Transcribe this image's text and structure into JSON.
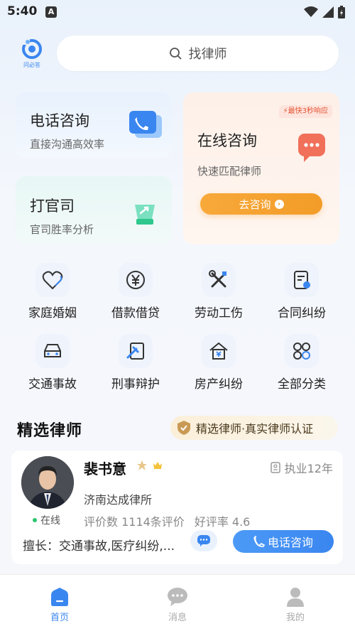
{
  "status_bar": {
    "time": "5:40",
    "notif_glyph": "A"
  },
  "header": {
    "logo_text": "问必答",
    "search_placeholder": "找律师"
  },
  "services": {
    "phone": {
      "title": "电话咨询",
      "subtitle": "直接沟通高效率"
    },
    "lawsuit": {
      "title": "打官司",
      "subtitle": "官司胜率分析"
    },
    "online": {
      "badge": "最快3秒响应",
      "title": "在线咨询",
      "subtitle": "快速匹配律师",
      "button": "去咨询"
    }
  },
  "categories": [
    {
      "label": "家庭婚姻",
      "icon": "heart-icon"
    },
    {
      "label": "借款借贷",
      "icon": "yen-icon"
    },
    {
      "label": "劳动工伤",
      "icon": "tools-icon"
    },
    {
      "label": "合同纠纷",
      "icon": "contract-icon"
    },
    {
      "label": "交通事故",
      "icon": "car-icon"
    },
    {
      "label": "刑事辩护",
      "icon": "gavel-icon"
    },
    {
      "label": "房产纠纷",
      "icon": "house-icon"
    },
    {
      "label": "全部分类",
      "icon": "grid-icon"
    }
  ],
  "featured": {
    "title": "精选律师",
    "badge": "精选律师·真实律师认证"
  },
  "lawyer": {
    "name": "裴书意",
    "experience": "执业12年",
    "firm": "济南达成律所",
    "status": "在线",
    "reviews": "评价数 1114条评价",
    "rating": "好评率 4.6",
    "specialty": "擅长：交通事故,医疗纠纷,...",
    "call_button": "电话咨询"
  },
  "tabs": [
    {
      "label": "首页",
      "active": true
    },
    {
      "label": "消息",
      "active": false
    },
    {
      "label": "我的",
      "active": false
    }
  ],
  "colors": {
    "primary": "#3a86f0",
    "orange": "#f39c28",
    "online_green": "#2ac56f"
  }
}
